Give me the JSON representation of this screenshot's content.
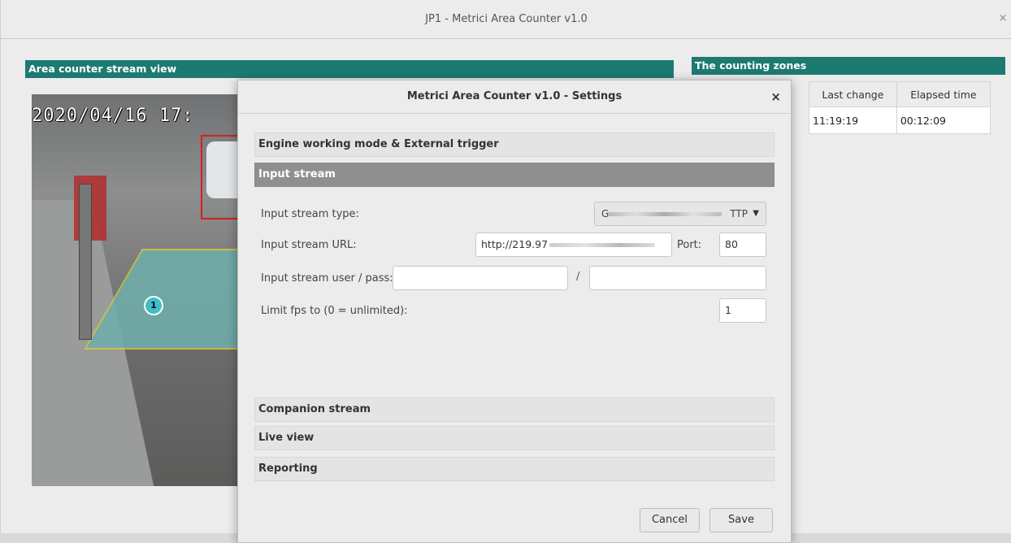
{
  "window": {
    "title": "JP1 - Metrici Area Counter v1.0",
    "close_glyph": "×"
  },
  "stream_panel": {
    "title": "Area counter stream view",
    "timestamp": "2020/04/16 17:",
    "zone_marker": "1"
  },
  "zones_panel": {
    "title": "The counting zones",
    "columns": [
      "Last change",
      "Elapsed time"
    ],
    "rows": [
      {
        "last_change": "11:19:19",
        "elapsed_time": "00:12:09"
      }
    ]
  },
  "dialog": {
    "title": "Metrici Area Counter v1.0 - Settings",
    "close_glyph": "×",
    "sections": {
      "engine": "Engine working mode & External trigger",
      "input_stream": "Input stream",
      "companion": "Companion stream",
      "live_view": "Live view",
      "reporting": "Reporting"
    },
    "fields": {
      "type_label": "Input stream type:",
      "type_prefix": "G",
      "type_suffix": "TTP",
      "url_label": "Input stream URL:",
      "url_value": "http://219.97",
      "port_label": "Port:",
      "port_value": "80",
      "userpass_label": "Input stream user / pass:",
      "userpass_separator": "/",
      "user_value": "",
      "pass_value": "",
      "fps_label": "Limit fps to (0 = unlimited):",
      "fps_value": "1"
    },
    "buttons": {
      "cancel": "Cancel",
      "save": "Save"
    }
  },
  "colors": {
    "panel_header": "#1d7a71",
    "active_section": "#8f8f8f",
    "zone_fill": "#6fb0ad",
    "detection_box": "#d32020"
  }
}
